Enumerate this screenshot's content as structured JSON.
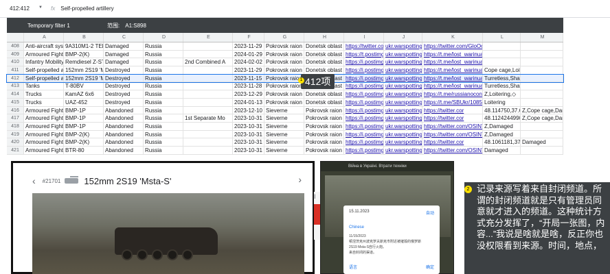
{
  "formula_bar": {
    "cell_ref": "412:412",
    "fx": "fx",
    "content": "Self-propelled artillery"
  },
  "filter": {
    "name": "Temporary filter 1",
    "range_label": "范围:",
    "range": "A1:S898"
  },
  "columns": [
    "",
    "A",
    "B",
    "C",
    "D",
    "E",
    "F",
    "G",
    "H",
    "I",
    "J",
    "K",
    "L",
    "M"
  ],
  "rows": [
    {
      "n": "408",
      "c": [
        "Anti-aircraft syste",
        "9A310M1-2 TEL",
        "Damaged",
        "Russia",
        "",
        "2023-11-29",
        "Pokrovsk raion",
        "Donetsk oblast",
        "https://twitter.com",
        "ukr.warspotting.n",
        "https://twitter.com/GloOouD/status/172990610537387841",
        "",
        ""
      ]
    },
    {
      "n": "409",
      "c": [
        "Armoured Fightin",
        "BMP-2(K)",
        "Damaged",
        "Russia",
        "",
        "2024-01-29",
        "Pokrovsk raion",
        "Donetsk oblast",
        "https://t.postimg",
        "ukr.warspotting.n",
        "https://t.me/lost_warinua/63107",
        "",
        ""
      ]
    },
    {
      "n": "410",
      "c": [
        "Infantry Mobility",
        "Remdiesel Z-STS",
        "Damaged",
        "Russia",
        "2nd Combined A",
        "2024-02-02",
        "Pokrovsk raion",
        "Donetsk oblast",
        "https://i.postimg",
        "ukr.warspotting.n",
        "https://t.me/lost_warinua/64472",
        "",
        ""
      ]
    },
    {
      "n": "411",
      "c": [
        "Self-propelled ar",
        "152mm 2S19 'M",
        "Destroyed",
        "Russia",
        "",
        "2023-11-29",
        "Pokrovsk raion",
        "Donetsk oblast",
        "https://i.postimg",
        "ukr.warspotting.n",
        "https://t.me/lost_warinua/58009",
        "Cope cage,Loitering",
        ""
      ]
    },
    {
      "n": "412",
      "c": [
        "Self-propelled ar",
        "152mm 2S19 'M",
        "Destroyed",
        "Russia",
        "",
        "2023-11-15",
        "Pokrovsk raion",
        "Donetsk oblast",
        "https://i.postimg",
        "ukr.warspotting.n",
        "https://t.me/lost_warinua/57157",
        "Turretless,Shattered",
        ""
      ]
    },
    {
      "n": "413",
      "c": [
        "Tanks",
        "T-80BV",
        "Destroyed",
        "Russia",
        "",
        "2023-11-28",
        "Pokrovsk raion",
        "Donetsk oblast",
        "https://i.postimg",
        "ukr.warspotting.n",
        "https://t.me/lost_warinua/61366",
        "Turretless,Shattered",
        ""
      ]
    },
    {
      "n": "414",
      "c": [
        "Trucks",
        "KamAZ 6x6",
        "Destroyed",
        "Russia",
        "",
        "2023-12-29",
        "Pokrovsk raion",
        "Donetsk oblast",
        "https://i.postimg",
        "ukr.warspotting.n",
        "https://t.me/russianocontext/1587",
        "Z,Loitering,◇",
        ""
      ]
    },
    {
      "n": "415",
      "c": [
        "Trucks",
        "UAZ-452",
        "Destroyed",
        "Russia",
        "",
        "2024-01-13",
        "Pokrovsk raion",
        "Donetsk oblast",
        "https://i.postimg",
        "ukr.warspotting.n",
        "https://t.me/SBUkr/10856",
        "Loitering",
        ""
      ]
    },
    {
      "n": "416",
      "c": [
        "Armoured Fightin",
        "BMP-1P",
        "Abandoned",
        "Russia",
        "",
        "2023-12-10",
        "Sieverne",
        "Pokrovsk raion",
        "https://i.postimg",
        "ukr.warspotting.n",
        "https://twitter.cor",
        "48.114750,37.63",
        "Z,Cope cage,Damaged"
      ]
    },
    {
      "n": "417",
      "c": [
        "Armoured Fightin",
        "BMP-1P",
        "Abandoned",
        "Russia",
        "1st Separate Mo",
        "2023-10-31",
        "Sieverne",
        "Pokrovsk raion",
        "https://i.postimg",
        "ukr.warspotting.n",
        "https://twitter.cor",
        "48.11242449900",
        "Z,Cope cage,Damaged"
      ]
    },
    {
      "n": "418",
      "c": [
        "Armoured Fightin",
        "BMP-1P",
        "Abandoned",
        "Russia",
        "",
        "2023-10-31",
        "Sieverne",
        "Pokrovsk raion",
        "https://i.postimg",
        "ukr.warspotting.n",
        "https://twitter.com/OSINTua/status",
        "Z,Damaged",
        ""
      ]
    },
    {
      "n": "419",
      "c": [
        "Armoured Fightin",
        "BMP-2(K)",
        "Abandoned",
        "Russia",
        "",
        "2023-10-31",
        "Sieverne",
        "Pokrovsk raion",
        "https://i.postimg",
        "ukr.warspotting.n",
        "https://twitter.com/OSINTua/status",
        "Z,Damaged",
        ""
      ]
    },
    {
      "n": "420",
      "c": [
        "Armoured Fightin",
        "BMP-2(K)",
        "Abandoned",
        "Russia",
        "",
        "2023-10-31",
        "Sieverne",
        "Pokrovsk raion",
        "https://i.postimg",
        "ukr.warspotting.n",
        "https://twitter.cor",
        "48.1061181,37.6",
        "Damaged"
      ]
    },
    {
      "n": "421",
      "c": [
        "Armoured Fightin",
        "BTR-80",
        "Abandoned",
        "Russia",
        "",
        "2023-10-31",
        "Sieverne",
        "Pokrovsk raion",
        "https://i.postimg",
        "ukr.warspotting.n",
        "https://twitter.com/OSINTua/status",
        "Damaged",
        ""
      ]
    }
  ],
  "selected_row": "412",
  "badge": {
    "num": "1",
    "text": "412项"
  },
  "card": {
    "id": "#21701",
    "name": "152mm 2S19 'Msta-S'"
  },
  "phone": {
    "header": "Війна в Україні. Втрати техніки",
    "dialog_date": "15.11.2023",
    "dialog_action": "自动",
    "lang": "Chinese",
    "body": "11/15/2023\n顿涅茨克州波克罗夫斯克市附近被摧毁的俄罗斯\n2S19 Msta-S自行火炮。\n来自封闭的渠道。",
    "btn_left": "语言",
    "btn_right": "确定"
  },
  "note": {
    "num": "2",
    "text": "记录来源写着来自封闭频道。所谓的封闭频道就是只有管理员同意就才进入的频道。这种统计方式充分发挥了，“开局一张图，内容...”我说是啥就是啥，反正你也没权限看到来源。时间，地点，"
  },
  "side_label": "I"
}
